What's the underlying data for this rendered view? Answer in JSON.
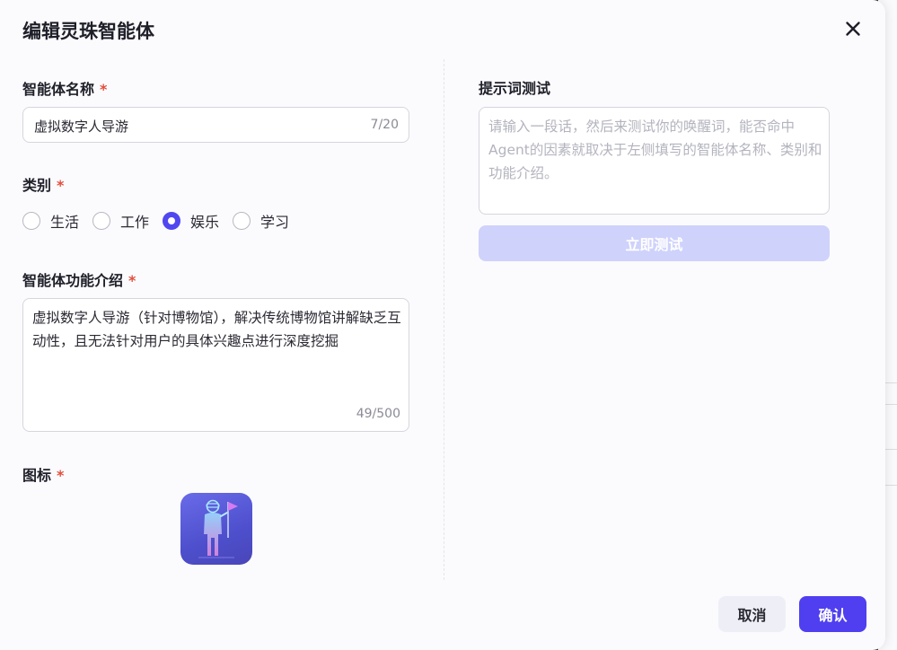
{
  "dialog": {
    "title": "编辑灵珠智能体"
  },
  "form": {
    "name": {
      "label": "智能体名称",
      "required_mark": "*",
      "value": "虚拟数字人导游",
      "count": "7/20"
    },
    "category": {
      "label": "类别",
      "required_mark": "*",
      "options": [
        "生活",
        "工作",
        "娱乐",
        "学习"
      ],
      "selected": "娱乐"
    },
    "description": {
      "label": "智能体功能介绍",
      "required_mark": "*",
      "value": "虚拟数字人导游（针对博物馆），解决传统博物馆讲解缺乏互动性，且无法针对用户的具体兴趣点进行深度挖掘",
      "count": "49/500"
    },
    "icon": {
      "label": "图标",
      "required_mark": "*",
      "icon_name": "tour-guide-avatar-icon"
    }
  },
  "prompt_test": {
    "label": "提示词测试",
    "placeholder": "请输入一段话，然后来测试你的唤醒词，能否命中Agent的因素就取决于左侧填写的智能体名称、类别和功能介绍。",
    "button_label": "立即测试"
  },
  "footer": {
    "cancel_label": "取消",
    "confirm_label": "确认"
  },
  "colors": {
    "primary": "#4f3ff0",
    "primary_disabled": "#cfd2fb",
    "required": "#e34d3a"
  }
}
